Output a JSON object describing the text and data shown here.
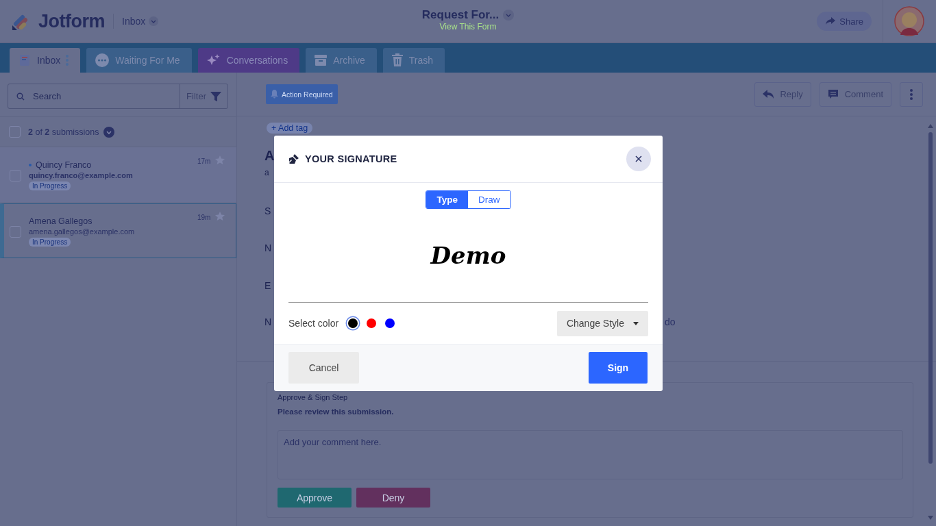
{
  "header": {
    "logo": "Jotform",
    "section": "Inbox",
    "form_title": "Request For...",
    "form_link": "View This Form",
    "share": "Share"
  },
  "tabs": [
    {
      "label": "Inbox",
      "kind": "inbox",
      "selected": true
    },
    {
      "label": "Waiting For Me",
      "kind": "waiting",
      "selected": false
    },
    {
      "label": "Conversations",
      "kind": "ai",
      "selected": false
    },
    {
      "label": "Archive",
      "kind": "archive",
      "selected": false
    },
    {
      "label": "Trash",
      "kind": "trash",
      "selected": false
    }
  ],
  "search": {
    "placeholder": "Search",
    "filter": "Filter"
  },
  "select_all": {
    "checked": false
  },
  "count_text": "**2** of **2** submissions",
  "submissions": [
    {
      "name": "Quincy Franco",
      "email": "quincy.franco@example.com",
      "status": "In Progress",
      "time": "17m",
      "unread": true,
      "checked": false,
      "selected": false
    },
    {
      "name": "Amena Gallegos",
      "email": "amena.gallegos@example.com",
      "status": "In Progress",
      "time": "19m",
      "unread": false,
      "checked": false,
      "selected": true
    }
  ],
  "toolbar": {
    "tag": "Action Required",
    "reply": "Reply",
    "comment": "Comment",
    "add_tag": "+ Add tag"
  },
  "detail_fragments": [
    "A",
    "a",
    "S",
    "N",
    "E",
    "N"
  ],
  "detail_trailing": "do",
  "approval": {
    "step": "Approve & Sign Step",
    "message": "Please review this submission.",
    "placeholder": "Add your comment here.",
    "approve": "Approve",
    "deny": "Deny"
  },
  "modal": {
    "title": "YOUR SIGNATURE",
    "modes": [
      {
        "label": "Type",
        "selected": true
      },
      {
        "label": "Draw",
        "selected": false
      }
    ],
    "signature": "Demo",
    "color_label": "Select color",
    "colors": [
      {
        "color": "#000000",
        "selected": true
      },
      {
        "color": "#ff0000",
        "selected": false
      },
      {
        "color": "#0000ff",
        "selected": false
      }
    ],
    "style_button": "Change Style",
    "cancel": "Cancel",
    "sign": "Sign"
  }
}
